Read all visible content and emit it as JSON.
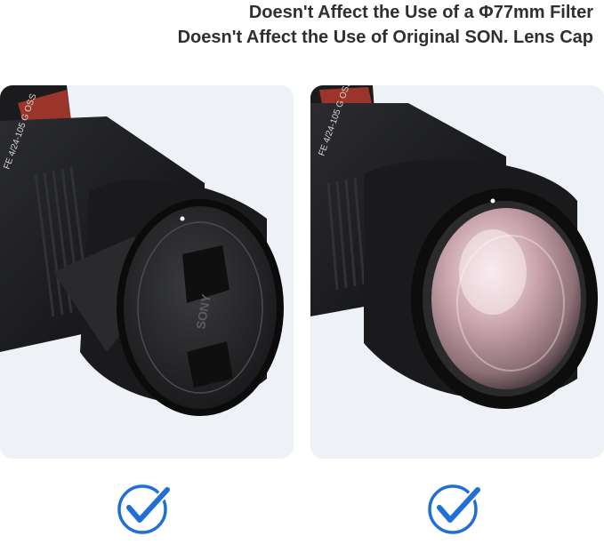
{
  "headline": {
    "line1": "Doesn't Affect the Use of a Φ77mm Filter",
    "line2": "Doesn't Affect the Use of Original SON. Lens Cap"
  },
  "images": {
    "left": {
      "subject": "camera lens with hood and lens cap attached"
    },
    "right": {
      "subject": "camera lens with hood and filter attached"
    }
  },
  "lens_engraving": "FE 4/24-105 G OSS",
  "cap_text": "SONY",
  "colors": {
    "check_blue": "#1f6fd6",
    "panel_bg": "#eef1f5",
    "heading": "#2f2f2f"
  },
  "icons": {
    "left_check": "checkmark-circle-icon",
    "right_check": "checkmark-circle-icon"
  }
}
